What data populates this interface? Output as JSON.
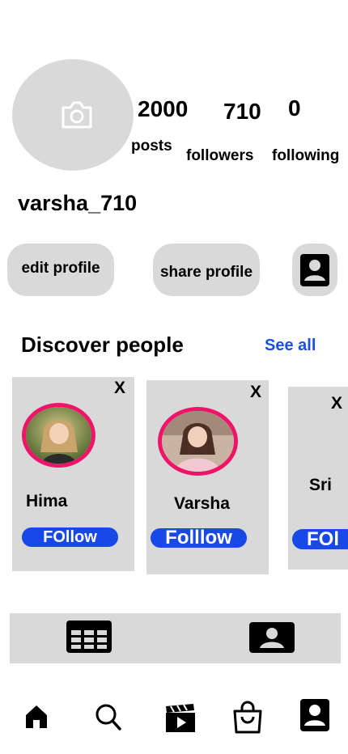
{
  "profile": {
    "username": "varsha_710",
    "avatar_icon": "camera-icon",
    "stats": [
      {
        "value": "2000",
        "label": "posts"
      },
      {
        "value": "710",
        "label": "followers"
      },
      {
        "value": "0",
        "label": "following"
      }
    ]
  },
  "actions": {
    "edit_label": "edit profile",
    "share_label": "share profile",
    "contact_icon": "add-person-icon"
  },
  "discover": {
    "title": "Discover people",
    "see_all": "See all",
    "cards": [
      {
        "name": "Hima",
        "follow": "FOllow",
        "close": "X"
      },
      {
        "name": "Varsha",
        "follow": "Folllow",
        "close": "X"
      },
      {
        "name": "Sri",
        "follow": "FOl",
        "close": "X"
      }
    ]
  },
  "tabs": [
    {
      "icon": "grid-icon"
    },
    {
      "icon": "tagged-person-icon"
    }
  ],
  "bottom_nav": [
    {
      "icon": "home-icon"
    },
    {
      "icon": "search-icon"
    },
    {
      "icon": "reels-icon"
    },
    {
      "icon": "shop-icon"
    },
    {
      "icon": "profile-icon"
    }
  ],
  "colors": {
    "accent_blue": "#1848e6",
    "link_blue": "#1a4fe0",
    "story_ring": "#f0136a",
    "panel_gray": "#d9d9d9"
  }
}
